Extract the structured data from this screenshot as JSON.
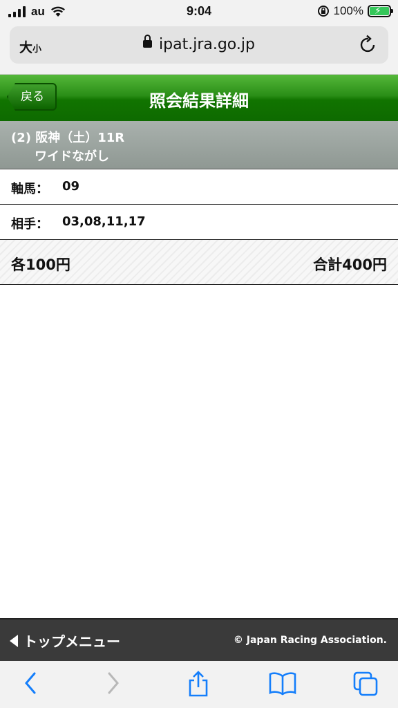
{
  "status_bar": {
    "carrier": "au",
    "time": "9:04",
    "battery": "100%"
  },
  "browser": {
    "text_size_label_big": "大",
    "text_size_label_small": "小",
    "url": "ipat.jra.go.jp"
  },
  "header": {
    "back_label": "戻る",
    "title": "照会結果詳細"
  },
  "race": {
    "line1": "(2) 阪神（土）11R",
    "line2": "ワイドながし"
  },
  "rows": {
    "jiku": {
      "label": "軸馬：",
      "value": "09"
    },
    "aite": {
      "label": "相手：",
      "value": "03,08,11,17"
    }
  },
  "summary": {
    "each": "各100円",
    "total": "合計400円"
  },
  "footer": {
    "top_menu": "トップメニュー",
    "copyright": "© Japan Racing Association."
  },
  "colors": {
    "header_green": "#117400",
    "race_gray": "#9aa29e",
    "footer_dark": "#3a3a3a",
    "ios_blue": "#147efb"
  },
  "icons": [
    "signal-icon",
    "wifi-icon",
    "orientation-lock-icon",
    "battery-icon",
    "lock-icon",
    "reload-icon",
    "back-arrow-icon",
    "forward-arrow-icon",
    "share-icon",
    "bookmarks-icon",
    "tabs-icon"
  ]
}
